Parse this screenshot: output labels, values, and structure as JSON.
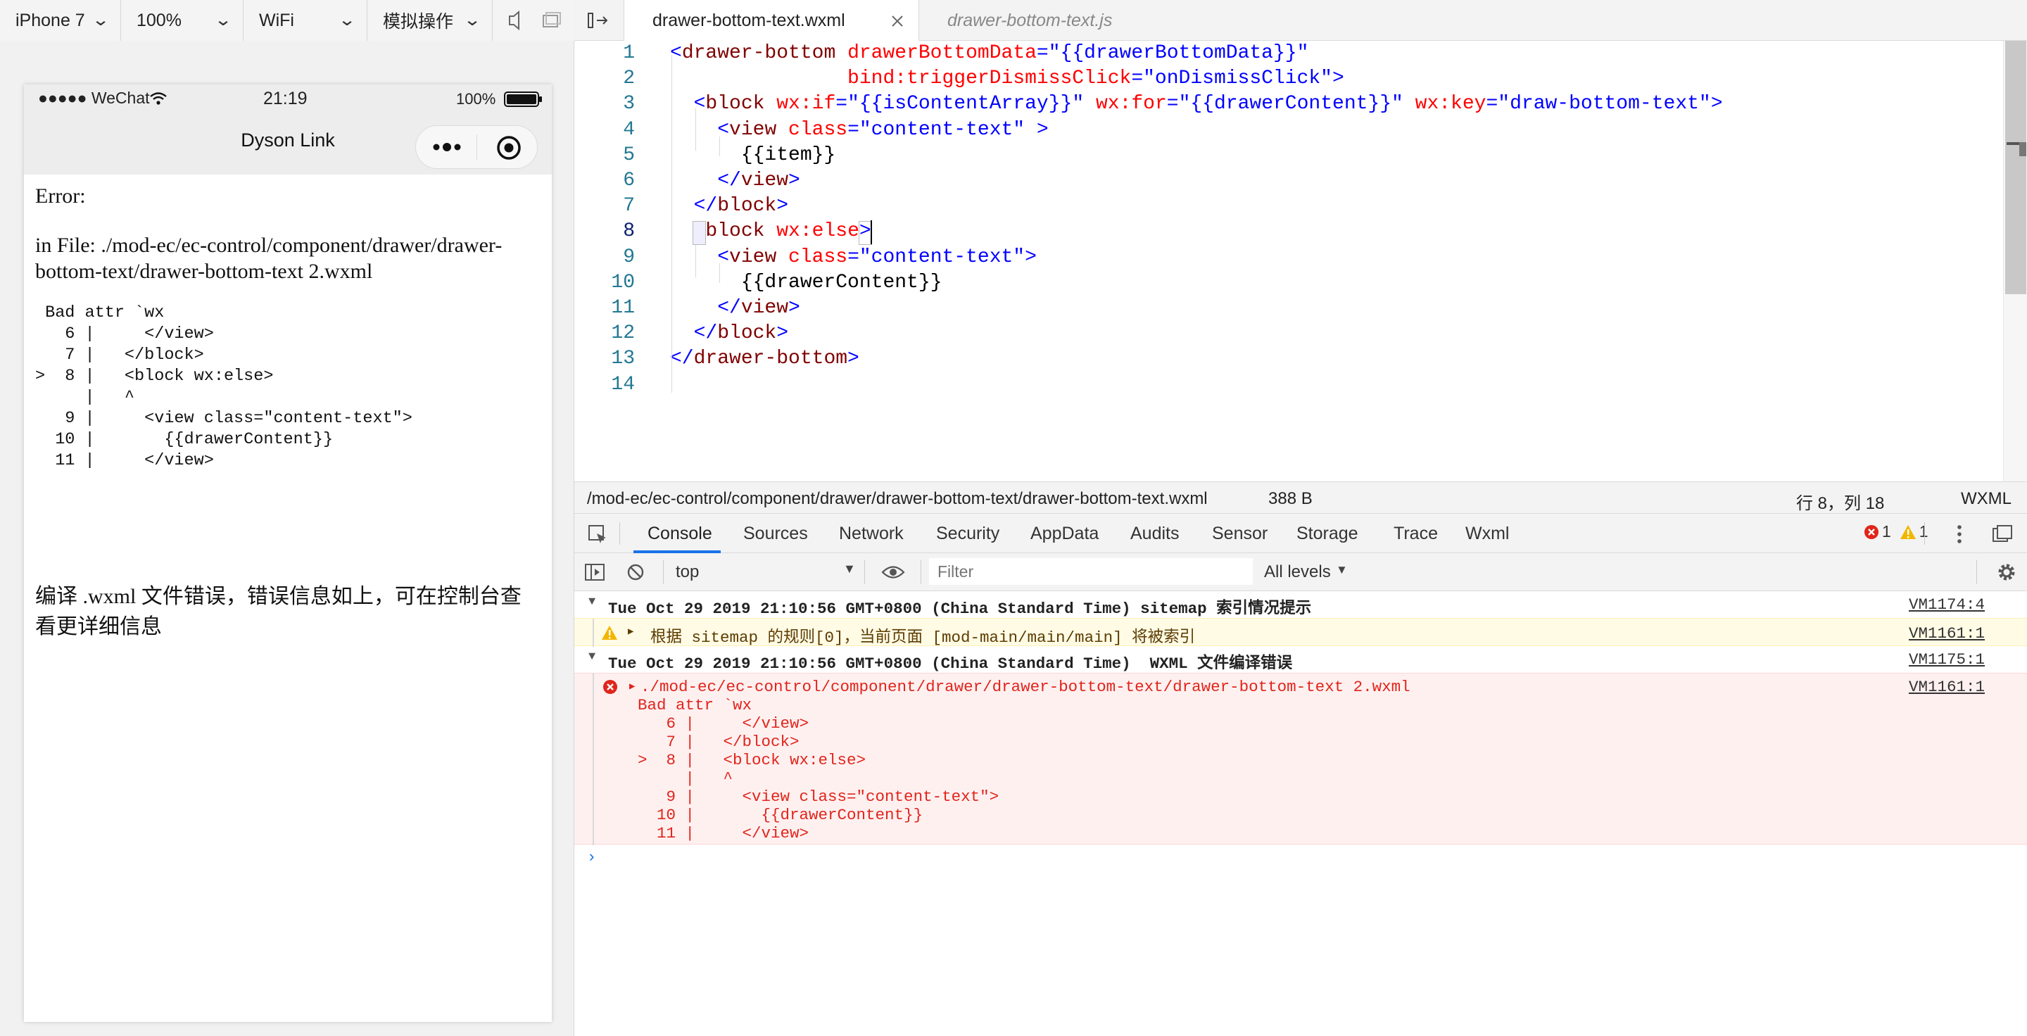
{
  "simulator_toolbar": {
    "device": "iPhone 7",
    "zoom": "100%",
    "network": "WiFi",
    "operation": "模拟操作"
  },
  "phone": {
    "status": {
      "carrier": "●●●●● WeChat",
      "time": "21:19",
      "battery": "100%"
    },
    "nav_title": "Dyson Link",
    "error_title": "Error:",
    "error_file": "in File: ./mod-ec/ec-control/component/drawer/drawer-bottom-text/drawer-bottom-text 2.wxml",
    "error_detail": " Bad attr `wx\n   6 |     </view>\n   7 |   </block>\n>  8 |   <block wx:else>\n     |   ^\n   9 |     <view class=\"content-text\">\n  10 |       {{drawerContent}}\n  11 |     </view>",
    "error_hint": "编译 .wxml 文件错误，错误信息如上，可在控制台查看更详细信息"
  },
  "editor": {
    "tabs": [
      {
        "label": "drawer-bottom-text.wxml",
        "active": true
      },
      {
        "label": "drawer-bottom-text.js",
        "active": false
      }
    ],
    "line_numbers": [
      "1",
      "2",
      "3",
      "4",
      "5",
      "6",
      "7",
      "8",
      "9",
      "10",
      "11",
      "12",
      "13",
      "14"
    ],
    "code": [
      [
        [
          "t-br",
          "<"
        ],
        [
          "t-tag",
          "drawer-bottom "
        ],
        [
          "t-attr",
          "drawerBottomData"
        ],
        [
          "t-br",
          "="
        ],
        [
          "t-str",
          "\"{{drawerBottomData}}\""
        ]
      ],
      [
        [
          "",
          "               "
        ],
        [
          "t-attr",
          "bind:triggerDismissClick"
        ],
        [
          "t-br",
          "="
        ],
        [
          "t-str",
          "\"onDismissClick\""
        ],
        [
          "t-br",
          ">"
        ]
      ],
      [
        [
          "",
          "  "
        ],
        [
          "t-br",
          "<"
        ],
        [
          "t-tag",
          "block "
        ],
        [
          "t-attr",
          "wx:if"
        ],
        [
          "t-br",
          "="
        ],
        [
          "t-str",
          "\"{{isContentArray}}\" "
        ],
        [
          "t-attr",
          "wx:for"
        ],
        [
          "t-br",
          "="
        ],
        [
          "t-str",
          "\"{{drawerContent}}\" "
        ],
        [
          "t-attr",
          "wx:key"
        ],
        [
          "t-br",
          "="
        ],
        [
          "t-str",
          "\"draw-bottom-text\""
        ],
        [
          "t-br",
          ">"
        ]
      ],
      [
        [
          "",
          "    "
        ],
        [
          "t-br",
          "<"
        ],
        [
          "t-tag",
          "view "
        ],
        [
          "t-attr",
          "class"
        ],
        [
          "t-br",
          "="
        ],
        [
          "t-str",
          "\"content-text\" "
        ],
        [
          "t-br",
          ">"
        ]
      ],
      [
        [
          "",
          "      {{item}}"
        ]
      ],
      [
        [
          "",
          "    "
        ],
        [
          "t-br",
          "</"
        ],
        [
          "t-tag",
          "view"
        ],
        [
          "t-br",
          ">"
        ]
      ],
      [
        [
          "",
          "  "
        ],
        [
          "t-br",
          "</"
        ],
        [
          "t-tag",
          "block"
        ],
        [
          "t-br",
          ">"
        ]
      ],
      [
        [
          "",
          "  "
        ],
        [
          "t-br",
          "<"
        ],
        [
          "t-tag",
          "block "
        ],
        [
          "t-attr",
          "wx:else"
        ],
        [
          "t-br",
          ">"
        ]
      ],
      [
        [
          "",
          "    "
        ],
        [
          "t-br",
          "<"
        ],
        [
          "t-tag",
          "view "
        ],
        [
          "t-attr",
          "class"
        ],
        [
          "t-br",
          "="
        ],
        [
          "t-str",
          "\"content-text\""
        ],
        [
          "t-br",
          ">"
        ]
      ],
      [
        [
          "",
          "      {{drawerContent}}"
        ]
      ],
      [
        [
          "",
          "    "
        ],
        [
          "t-br",
          "</"
        ],
        [
          "t-tag",
          "view"
        ],
        [
          "t-br",
          ">"
        ]
      ],
      [
        [
          "",
          "  "
        ],
        [
          "t-br",
          "</"
        ],
        [
          "t-tag",
          "block"
        ],
        [
          "t-br",
          ">"
        ]
      ],
      [
        [
          "t-br",
          "</"
        ],
        [
          "t-tag",
          "drawer-bottom"
        ],
        [
          "t-br",
          ">"
        ]
      ],
      [
        [
          "",
          ""
        ]
      ]
    ],
    "file_path": "/mod-ec/ec-control/component/drawer/drawer-bottom-text/drawer-bottom-text.wxml",
    "file_size": "388 B",
    "cursor_pos": "行 8，列 18",
    "language": "WXML"
  },
  "devtools": {
    "tabs": [
      "Console",
      "Sources",
      "Network",
      "Security",
      "AppData",
      "Audits",
      "Sensor",
      "Storage",
      "Trace",
      "Wxml"
    ],
    "error_count": "1",
    "warning_count": "1",
    "context": "top",
    "filter_placeholder": "Filter",
    "levels": "All levels",
    "messages": {
      "group1": "Tue Oct 29 2019 21:10:56 GMT+0800 (China Standard Time) sitemap 索引情况提示",
      "group1_link": "VM1174:4",
      "warn": "根据 sitemap 的规则[0]，当前页面 [mod-main/main/main] 将被索引",
      "warn_link": "VM1161:1",
      "group2": "Tue Oct 29 2019 21:10:56 GMT+0800 (China Standard Time)  WXML 文件编译错误",
      "group2_link": "VM1175:1",
      "error_file": "./mod-ec/ec-control/component/drawer/drawer-bottom-text/drawer-bottom-text 2.wxml",
      "error_link": "VM1161:1",
      "error_body": "Bad attr `wx\n   6 |     </view>\n   7 |   </block>\n>  8 |   <block wx:else>\n     |   ^\n   9 |     <view class=\"content-text\">\n  10 |       {{drawerContent}}\n  11 |     </view>"
    }
  }
}
